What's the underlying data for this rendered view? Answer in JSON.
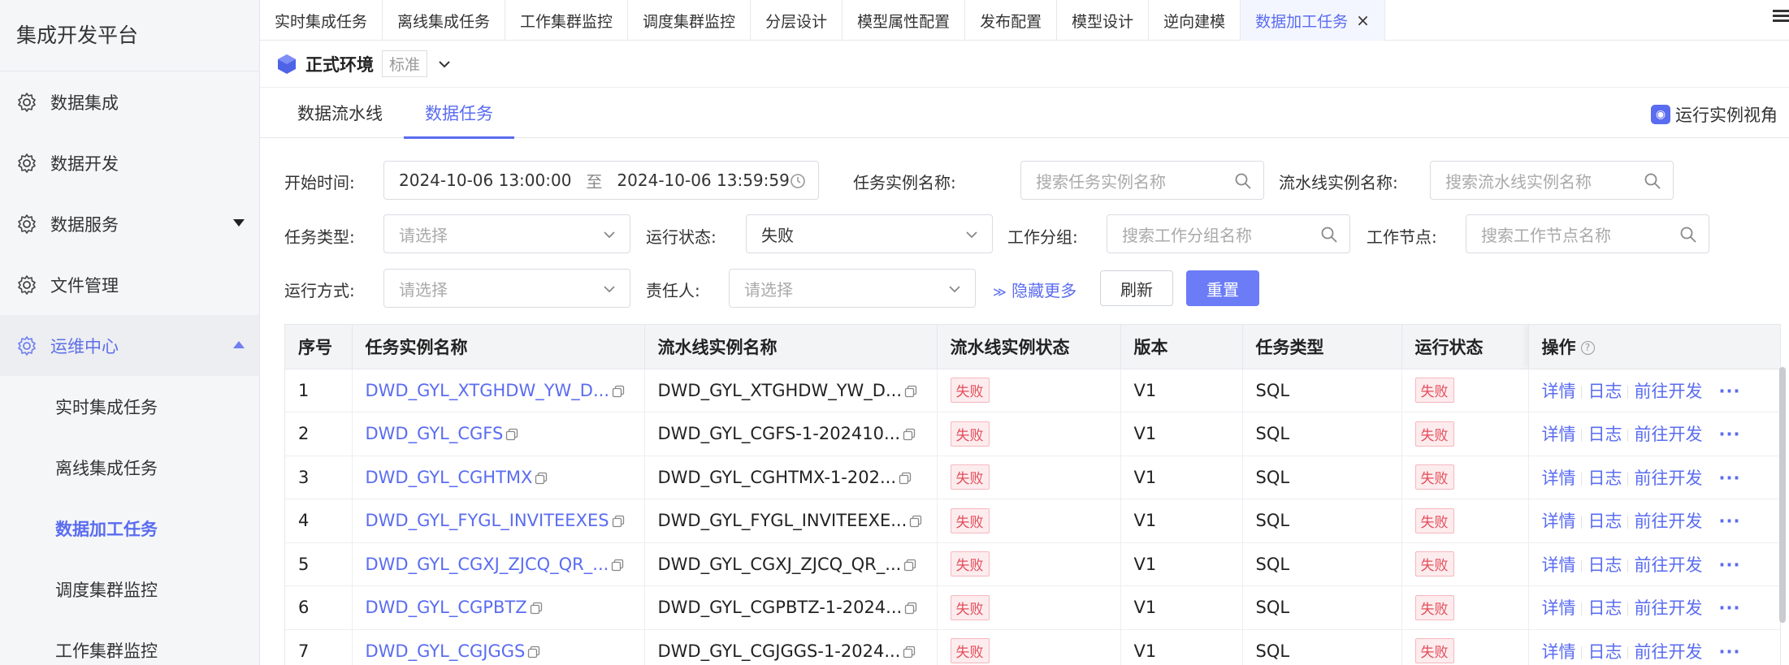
{
  "sidebar": {
    "title": "集成开发平台",
    "items": [
      {
        "label": "数据集成"
      },
      {
        "label": "数据开发"
      },
      {
        "label": "数据服务"
      },
      {
        "label": "文件管理"
      },
      {
        "label": "运维中心"
      }
    ],
    "sub_items": [
      {
        "label": "实时集成任务"
      },
      {
        "label": "离线集成任务"
      },
      {
        "label": "数据加工任务"
      },
      {
        "label": "调度集群监控"
      },
      {
        "label": "工作集群监控"
      }
    ]
  },
  "tabs": [
    {
      "label": "实时集成任务"
    },
    {
      "label": "离线集成任务"
    },
    {
      "label": "工作集群监控"
    },
    {
      "label": "调度集群监控"
    },
    {
      "label": "分层设计"
    },
    {
      "label": "模型属性配置"
    },
    {
      "label": "发布配置"
    },
    {
      "label": "模型设计"
    },
    {
      "label": "逆向建模"
    },
    {
      "label": "数据加工任务"
    }
  ],
  "tab_close": "×",
  "env": {
    "name": "正式环境",
    "tag": "标准"
  },
  "subtabs": [
    {
      "label": "数据流水线"
    },
    {
      "label": "数据任务"
    }
  ],
  "run_view": "运行实例视角",
  "filters": {
    "start_time_label": "开始时间:",
    "start_time": "2024-10-06 13:00:00",
    "to": "至",
    "end_time": "2024-10-06 13:59:59",
    "task_instance_label": "任务实例名称:",
    "task_instance_ph": "搜索任务实例名称",
    "pipeline_instance_label": "流水线实例名称:",
    "pipeline_instance_ph": "搜索流水线实例名称",
    "task_type_label": "任务类型:",
    "task_type_ph": "请选择",
    "run_status_label": "运行状态:",
    "run_status": "失败",
    "work_group_label": "工作分组:",
    "work_group_ph": "搜索工作分组名称",
    "work_node_label": "工作节点:",
    "work_node_ph": "搜索工作节点名称",
    "run_mode_label": "运行方式:",
    "run_mode_ph": "请选择",
    "owner_label": "责任人:",
    "owner_ph": "请选择",
    "hide_more": "隐藏更多",
    "refresh": "刷新",
    "reset": "重置"
  },
  "table": {
    "headers": [
      "序号",
      "任务实例名称",
      "流水线实例名称",
      "流水线实例状态",
      "版本",
      "任务类型",
      "运行状态",
      "操作"
    ],
    "ops": [
      "详情",
      "日志",
      "前往开发",
      "···"
    ],
    "rows": [
      {
        "no": "1",
        "task": "DWD_GYL_XTGHDW_YW_D...",
        "pipeline": "DWD_GYL_XTGHDW_YW_D...",
        "pstatus": "失败",
        "version": "V1",
        "type": "SQL",
        "status": "失败"
      },
      {
        "no": "2",
        "task": "DWD_GYL_CGFS",
        "pipeline": "DWD_GYL_CGFS-1-202410...",
        "pstatus": "失败",
        "version": "V1",
        "type": "SQL",
        "status": "失败"
      },
      {
        "no": "3",
        "task": "DWD_GYL_CGHTMX",
        "pipeline": "DWD_GYL_CGHTMX-1-202...",
        "pstatus": "失败",
        "version": "V1",
        "type": "SQL",
        "status": "失败"
      },
      {
        "no": "4",
        "task": "DWD_GYL_FYGL_INVITEEXES",
        "pipeline": "DWD_GYL_FYGL_INVITEEXE...",
        "pstatus": "失败",
        "version": "V1",
        "type": "SQL",
        "status": "失败"
      },
      {
        "no": "5",
        "task": "DWD_GYL_CGXJ_ZJCQ_QR_...",
        "pipeline": "DWD_GYL_CGXJ_ZJCQ_QR_...",
        "pstatus": "失败",
        "version": "V1",
        "type": "SQL",
        "status": "失败"
      },
      {
        "no": "6",
        "task": "DWD_GYL_CGPBTZ",
        "pipeline": "DWD_GYL_CGPBTZ-1-2024...",
        "pstatus": "失败",
        "version": "V1",
        "type": "SQL",
        "status": "失败"
      },
      {
        "no": "7",
        "task": "DWD_GYL_CGJGGS",
        "pipeline": "DWD_GYL_CGJGGS-1-2024...",
        "pstatus": "失败",
        "version": "V1",
        "type": "SQL",
        "status": "失败"
      }
    ]
  }
}
